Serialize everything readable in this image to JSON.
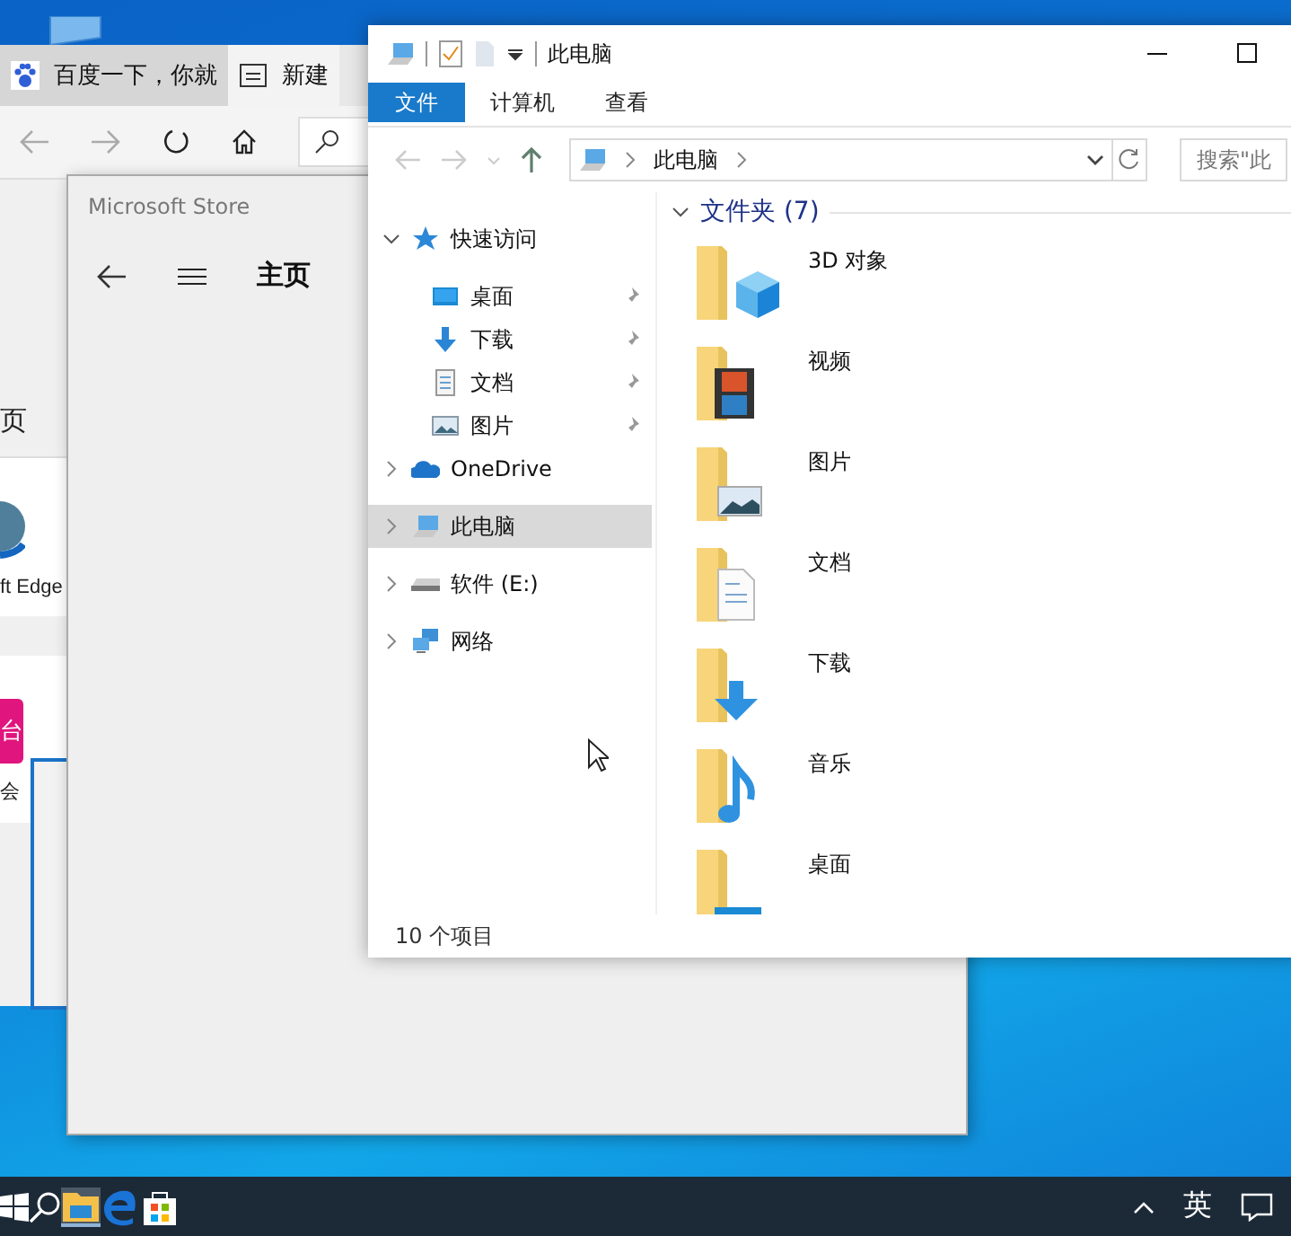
{
  "browser": {
    "tabs": [
      {
        "label": "百度一下，你就",
        "selected": true,
        "kind": "paw"
      },
      {
        "label": "新建",
        "selected": false,
        "kind": "page"
      }
    ],
    "texts": [
      "页",
      "ft Edge",
      "台",
      "会"
    ]
  },
  "store": {
    "title": "Microsoft Store",
    "heading": "主页"
  },
  "explorer": {
    "title": "此电脑",
    "ribbon_tabs": [
      {
        "label": "文件",
        "selected": true
      },
      {
        "label": "计算机",
        "selected": false
      },
      {
        "label": "查看",
        "selected": false
      }
    ],
    "breadcrumb": "此电脑",
    "search": {
      "placeholder": "搜索\"此"
    },
    "nav": [
      {
        "label": "快速访问",
        "kind": "star",
        "expanded": true,
        "selected": false,
        "children": [
          {
            "label": "桌面",
            "kind": "desktop",
            "pinned": true
          },
          {
            "label": "下载",
            "kind": "download",
            "pinned": true
          },
          {
            "label": "文档",
            "kind": "document",
            "pinned": true
          },
          {
            "label": "图片",
            "kind": "pictures",
            "pinned": true
          }
        ]
      },
      {
        "label": "OneDrive",
        "kind": "cloud",
        "expanded": false,
        "selected": false
      },
      {
        "label": "此电脑",
        "kind": "computer",
        "expanded": false,
        "selected": true
      },
      {
        "label": "软件 (E:)",
        "kind": "drive",
        "expanded": false,
        "selected": false
      },
      {
        "label": "网络",
        "kind": "network",
        "expanded": false,
        "selected": false
      }
    ],
    "group": {
      "title": "文件夹 (7)",
      "expanded": true
    },
    "folders": [
      {
        "name": "3D 对象",
        "kind": "cube"
      },
      {
        "name": "视频",
        "kind": "film"
      },
      {
        "name": "图片",
        "kind": "pictures"
      },
      {
        "name": "文档",
        "kind": "document"
      },
      {
        "name": "下载",
        "kind": "download"
      },
      {
        "name": "音乐",
        "kind": "music"
      },
      {
        "name": "桌面",
        "kind": "desktop"
      }
    ],
    "status": "10 个项目"
  },
  "taskbar": {
    "apps": [
      {
        "kind": "explorer",
        "active": true
      },
      {
        "kind": "edge",
        "active": false
      },
      {
        "kind": "store",
        "active": false
      }
    ],
    "ime": "英"
  }
}
